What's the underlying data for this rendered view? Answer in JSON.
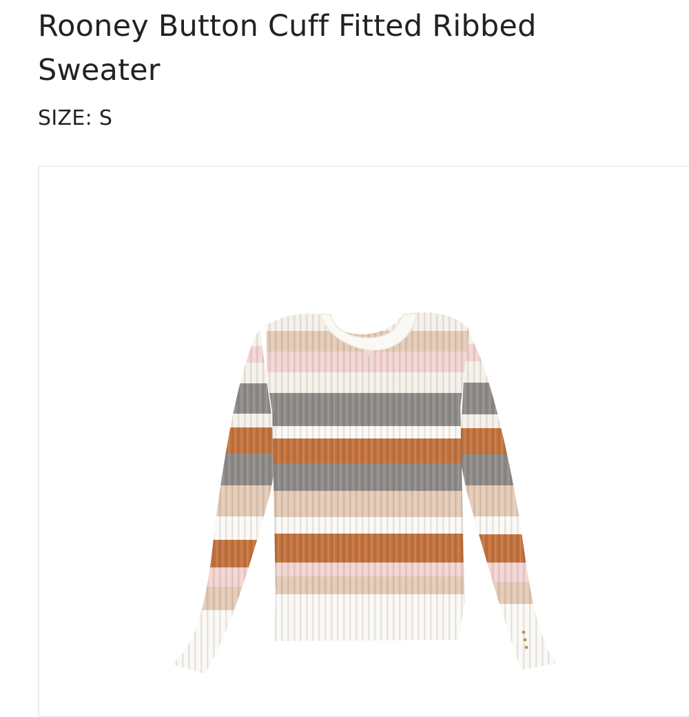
{
  "product": {
    "title": "Rooney Button Cuff Fitted Ribbed Sweater",
    "size_text": "SIZE: S"
  },
  "image": {
    "subject": "striped-ribbed-sweater",
    "colors": {
      "cream": "#f5f1ea",
      "beige": "#e5cbb7",
      "pink": "#f3d5d3",
      "gray": "#8f8c8a",
      "rust": "#c4743f",
      "white": "#fbf9f5"
    }
  }
}
